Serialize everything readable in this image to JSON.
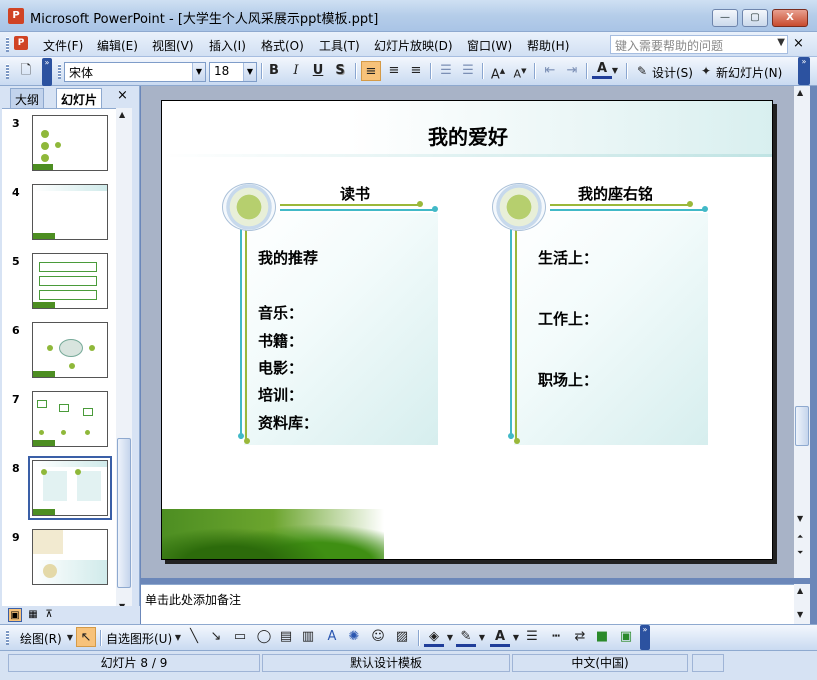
{
  "window": {
    "title": "Microsoft PowerPoint - [大学生个人风采展示ppt模板.ppt]",
    "minimize": "—",
    "restore": "▢",
    "close": "X"
  },
  "menubar": {
    "items": [
      "文件(F)",
      "编辑(E)",
      "视图(V)",
      "插入(I)",
      "格式(O)",
      "工具(T)",
      "幻灯片放映(D)",
      "窗口(W)",
      "帮助(H)"
    ],
    "help_placeholder": "键入需要帮助的问题",
    "close": "×"
  },
  "toolbar": {
    "font": "宋体",
    "font_size": "18",
    "bold": "B",
    "italic": "I",
    "underline": "U",
    "shadow": "S",
    "design_label": "设计(S)",
    "new_slide_label": "新幻灯片(N)"
  },
  "outline_pane": {
    "tab_outline": "大纲",
    "tab_slides": "幻灯片",
    "close": "×",
    "slide_numbers": [
      "3",
      "4",
      "5",
      "6",
      "7",
      "8",
      "9"
    ],
    "selected": "8"
  },
  "slide": {
    "title": "我的爱好",
    "left_card": {
      "heading": "读书",
      "recommend": "我的推荐",
      "items": [
        "音乐：",
        "书籍：",
        "电影：",
        "培训：",
        "资料库："
      ]
    },
    "right_card": {
      "heading": "我的座右铭",
      "items": [
        "生活上：",
        "工作上：",
        "职场上："
      ]
    },
    "colors": {
      "accent_teal": "#41b9c7",
      "accent_green": "#9ab83a"
    }
  },
  "notes": {
    "placeholder": "单击此处添加备注"
  },
  "drawbar": {
    "draw_label": "绘图(R)",
    "autoshape_label": "自选图形(U)"
  },
  "statusbar": {
    "slide_position": "幻灯片 8 / 9",
    "template": "默认设计模板",
    "language": "中文(中国)"
  }
}
